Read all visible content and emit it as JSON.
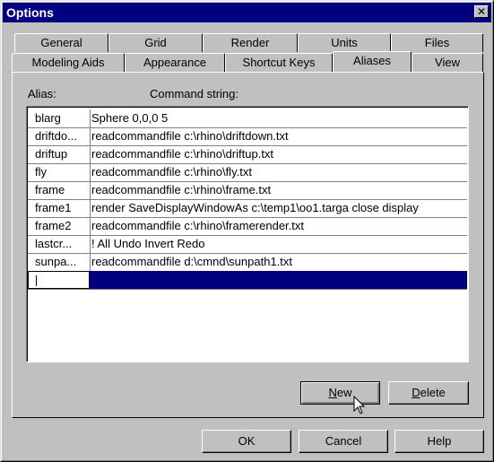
{
  "window": {
    "title": "Options",
    "close_glyph": "✕"
  },
  "tabs_back": [
    {
      "label": "General"
    },
    {
      "label": "Grid"
    },
    {
      "label": "Render"
    },
    {
      "label": "Units"
    },
    {
      "label": "Files"
    }
  ],
  "tabs_front": [
    {
      "label": "Modeling Aids"
    },
    {
      "label": "Appearance"
    },
    {
      "label": "Shortcut Keys"
    },
    {
      "label": "Aliases"
    },
    {
      "label": "View"
    }
  ],
  "active_tab": "Aliases",
  "columns": {
    "alias": "Alias:",
    "command": "Command string:"
  },
  "rows": [
    {
      "alias": "blarg",
      "command": "Sphere 0,0,0 5"
    },
    {
      "alias": "driftdo...",
      "command": "readcommandfile c:\\rhino\\driftdown.txt"
    },
    {
      "alias": "driftup",
      "command": "readcommandfile c:\\rhino\\driftup.txt"
    },
    {
      "alias": "fly",
      "command": "readcommandfile c:\\rhino\\fly.txt"
    },
    {
      "alias": "frame",
      "command": "readcommandfile c:\\rhino\\frame.txt"
    },
    {
      "alias": "frame1",
      "command": "render SaveDisplayWindowAs c:\\temp1\\oo1.targa close display"
    },
    {
      "alias": "frame2",
      "command": "readcommandfile c:\\rhino\\framerender.txt"
    },
    {
      "alias": "lastcr...",
      "command": "! All Undo Invert Redo"
    },
    {
      "alias": "sunpa...",
      "command": "readcommandfile d:\\cmnd\\sunpath1.txt"
    },
    {
      "alias": "",
      "command": ""
    }
  ],
  "buttons": {
    "new_pre": "",
    "new_u": "N",
    "new_post": "ew",
    "delete_pre": "",
    "delete_u": "D",
    "delete_post": "elete",
    "ok": "OK",
    "cancel": "Cancel",
    "help": "Help"
  },
  "colors": {
    "selection": "#000080",
    "face": "#c0c0c0",
    "titlebar": "#000080"
  }
}
